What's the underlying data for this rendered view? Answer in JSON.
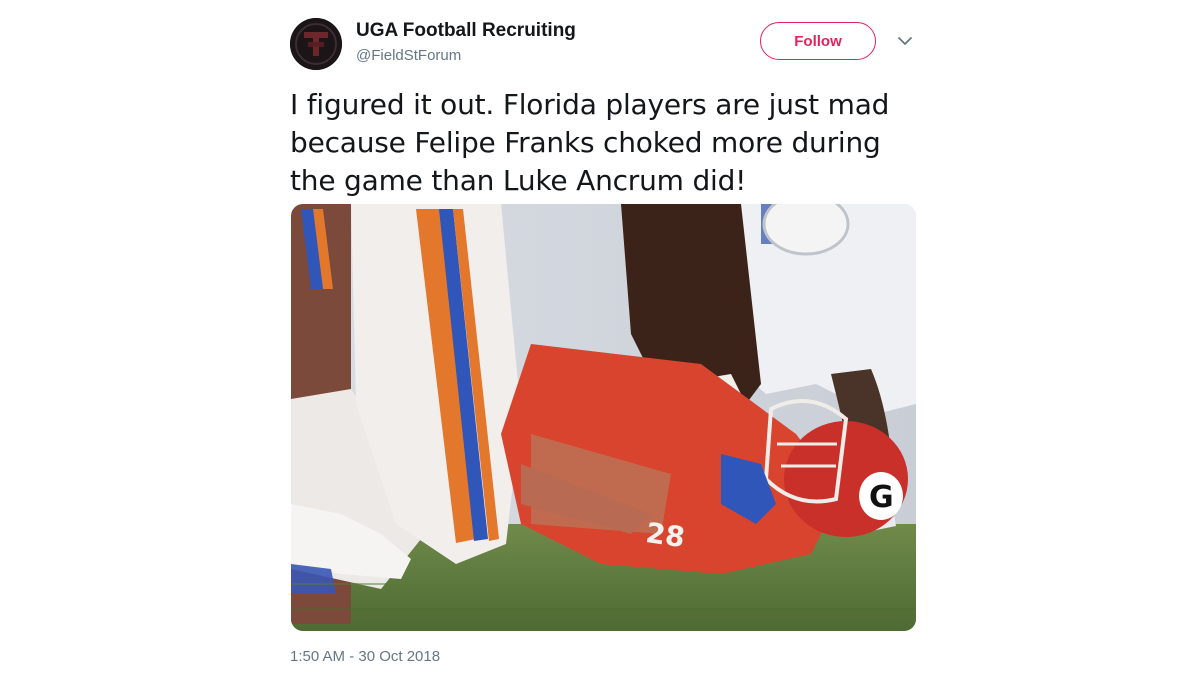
{
  "account": {
    "name": "UGA Football Recruiting",
    "handle": "@FieldStForum"
  },
  "follow_button": {
    "label": "Follow"
  },
  "tweet": {
    "text_lines": [
      "I figured it out. Florida players are just mad",
      "because Felipe Franks choked more during",
      "the game than Luke Ancrum did!"
    ],
    "timestamp": "1:50 AM - 30 Oct 2018"
  },
  "colors": {
    "follow_accent": "#e0245e",
    "text": "#14171a",
    "muted": "#657786"
  },
  "icons": {
    "menu": "chevron-down-icon"
  }
}
